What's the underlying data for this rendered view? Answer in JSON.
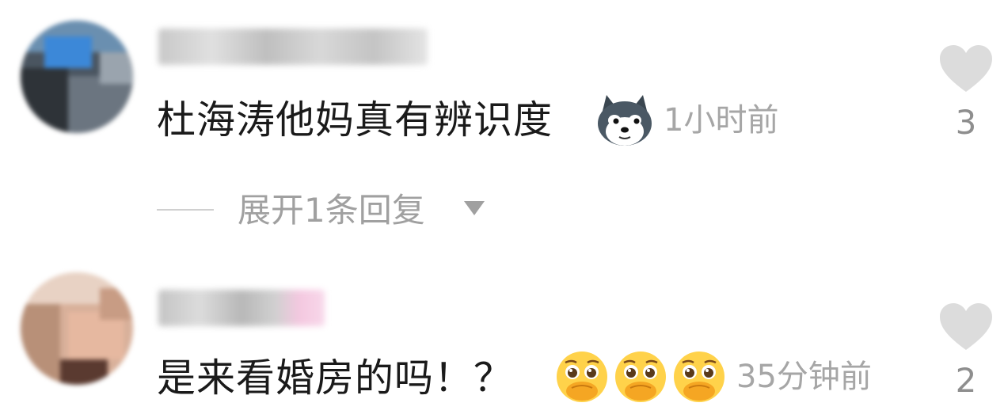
{
  "comments": [
    {
      "text": "杜海涛他妈真有辨识度",
      "emoji": "husky-dog-emoji",
      "time": "1小时前",
      "likes": "3",
      "expand_label": "展开1条回复"
    },
    {
      "text": "是来看婚房的吗！？",
      "emoji": "pleading-face-covering-mouth-emoji",
      "emoji_count": 3,
      "time": "35分钟前",
      "likes": "2"
    }
  ],
  "colors": {
    "text": "#1a1a1a",
    "meta": "#a6a6a6",
    "heart": "#dcdcdc"
  }
}
